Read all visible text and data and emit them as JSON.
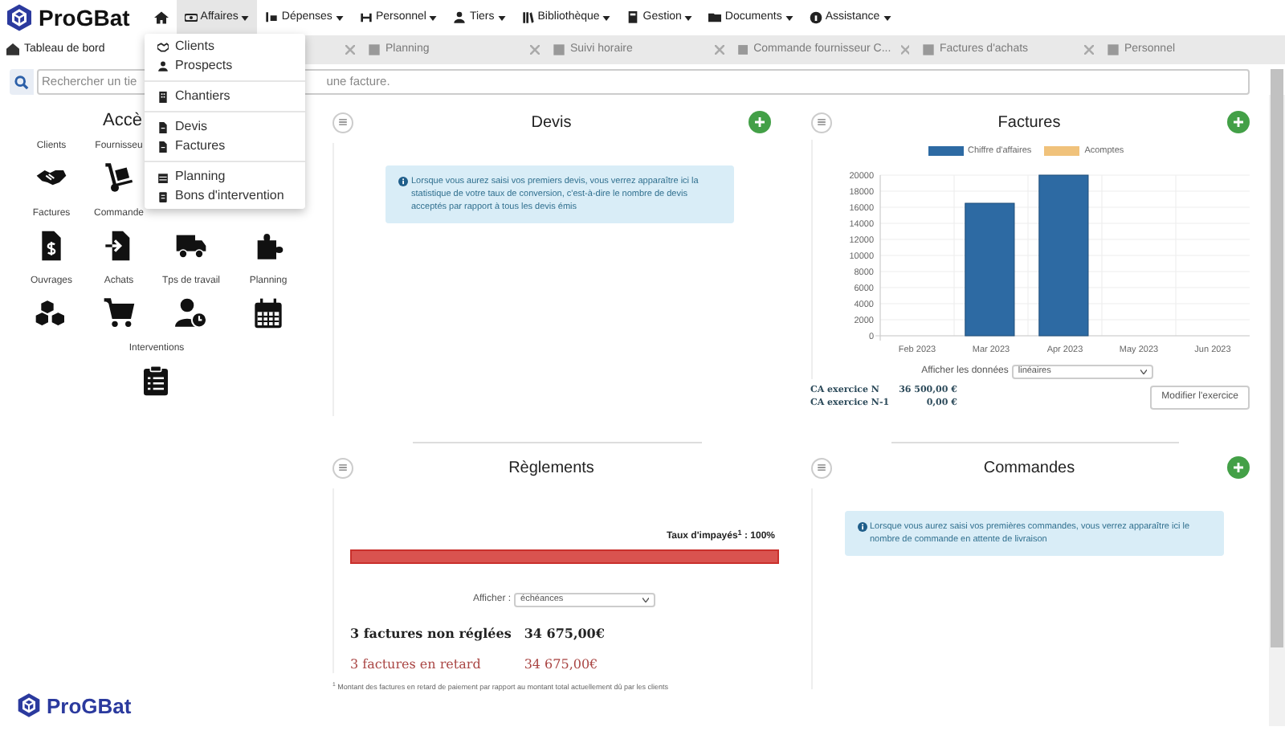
{
  "brand": "ProGBat",
  "nav": [
    {
      "label": "Affaires",
      "selected": true
    },
    {
      "label": "Dépenses",
      "selected": false
    },
    {
      "label": "Personnel",
      "selected": false
    },
    {
      "label": "Tiers",
      "selected": false
    },
    {
      "label": "Bibliothèque",
      "selected": false
    },
    {
      "label": "Gestion",
      "selected": false
    },
    {
      "label": "Documents",
      "selected": false
    },
    {
      "label": "Assistance",
      "selected": false
    }
  ],
  "open_menu": {
    "groups": [
      [
        "Clients",
        "Prospects"
      ],
      [
        "Chantiers"
      ],
      [
        "Devis",
        "Factures"
      ],
      [
        "Planning",
        "Bons d'intervention"
      ]
    ]
  },
  "tabs": [
    {
      "label": "Tableau de bord",
      "selected": true,
      "closable": false
    },
    {
      "selected": false,
      "closable": true
    },
    {
      "label": "Planning",
      "selected": false,
      "closable": true
    },
    {
      "label": "Suivi horaire",
      "selected": false,
      "closable": true
    },
    {
      "label": "Commande fournisseur C...",
      "selected": false,
      "closable": true
    },
    {
      "label": "Factures d'achats",
      "selected": false,
      "closable": true
    },
    {
      "label": "Personnel",
      "selected": false,
      "closable": false
    }
  ],
  "search": {
    "placeholder_start": "Rechercher un tie",
    "placeholder_end": "une facture."
  },
  "quick_access": {
    "title": "Accè",
    "rows": [
      [
        {
          "label": "Clients"
        },
        {
          "label": "Fournisseu"
        }
      ],
      [
        {
          "label": "Factures"
        },
        {
          "label": "Commande"
        },
        {},
        {}
      ],
      [
        {
          "label": "Ouvrages"
        },
        {
          "label": "Achats"
        },
        {
          "label": "Tps de travail"
        },
        {
          "label": "Planning"
        }
      ],
      [
        {
          "label": "Interventions"
        }
      ]
    ]
  },
  "devis": {
    "title": "Devis",
    "info": "Lorsque vous aurez saisi vos premiers devis, vous verrez apparaître ici la statistique de votre taux de conversion, c'est-à-dire le nombre de devis acceptés par rapport à tous les devis émis"
  },
  "factures": {
    "title": "Factures",
    "chart_data": {
      "type": "bar",
      "categories": [
        "Feb 2023",
        "Mar 2023",
        "Apr 2023",
        "May 2023",
        "Jun 2023"
      ],
      "series": [
        {
          "name": "Chiffre d'affaires",
          "color": "#2d6aa3",
          "values": [
            0,
            16500,
            20000,
            0,
            0
          ]
        },
        {
          "name": "Acomptes",
          "color": "#f0c27b",
          "values": [
            0,
            0,
            0,
            0,
            0
          ]
        }
      ],
      "ylim": [
        0,
        20000
      ],
      "grid": true,
      "yticks": [
        0,
        2000,
        4000,
        6000,
        8000,
        10000,
        12000,
        14000,
        16000,
        18000,
        20000
      ]
    },
    "display_label": "Afficher les données",
    "display_value": "linéaires",
    "ca": [
      {
        "label": "CA exercice N",
        "value": "36 500,00 €"
      },
      {
        "label": "CA exercice N-1",
        "value": "0,00 €"
      }
    ],
    "button": "Modifier l'exercice"
  },
  "reglements": {
    "title": "Règlements",
    "rate_label": "Taux d'impayés$^{1}$ : 100%",
    "level": 1,
    "display_label": "Afficher :",
    "display_value": "échéances",
    "stats": [
      {
        "label": "3 factures non réglées",
        "value": "34 675,00€",
        "late": false
      },
      {
        "label": "3 factures en retard",
        "value": "34 675,00€",
        "late": true
      }
    ],
    "footnote": "$^{1}$ Montant des factures en retard de paiement par rapport au montant total actuellement dû par les clients"
  },
  "commandes": {
    "title": "Commandes",
    "info": "Lorsque vous aurez saisi vos premières commandes, vous verrez apparaître ici le nombre de commande en attente de livraison"
  },
  "footer_brand": "ProGBat"
}
